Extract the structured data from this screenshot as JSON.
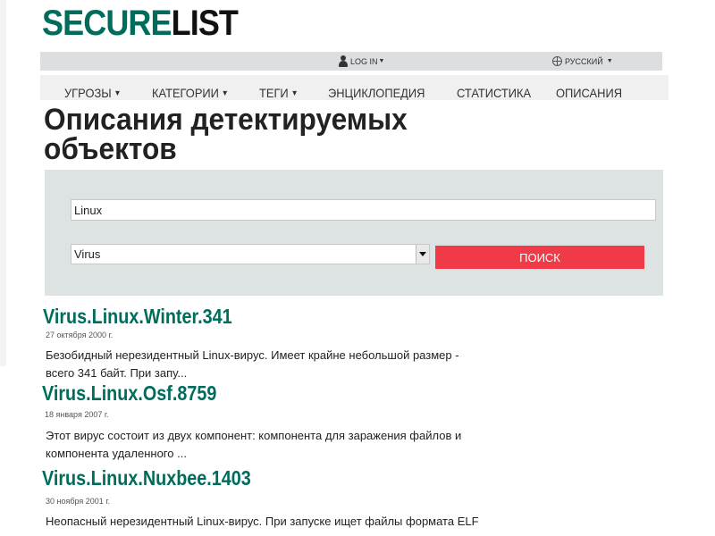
{
  "logo": {
    "part1": "SECURE",
    "part2": "LIST"
  },
  "topbar": {
    "login": "LOG IN",
    "language": "РУССКИЙ"
  },
  "nav": {
    "items": [
      {
        "label": "Угрозы",
        "dropdown": true
      },
      {
        "label": "Категории",
        "dropdown": true
      },
      {
        "label": "Теги",
        "dropdown": true
      },
      {
        "label": "Энциклопедия",
        "dropdown": false
      },
      {
        "label": "Статистика",
        "dropdown": false
      },
      {
        "label": "Описания",
        "dropdown": false
      }
    ]
  },
  "page": {
    "title": "Описания детектируемых объектов"
  },
  "search": {
    "query": "Linux",
    "type_selected": "Virus",
    "button_label": "ПОИСК",
    "button_color": "#f03a47"
  },
  "results": [
    {
      "title": "Virus.Linux.Winter.341",
      "date": "27 октября 2000 г.",
      "desc_line1": "Безобидный нерезидентный Linux-вирус. Имеет крайне небольшой размер -",
      "desc_line2": "всего 341 байт. При запу..."
    },
    {
      "title": "Virus.Linux.Osf.8759",
      "date": "18 января 2007 г.",
      "desc_line1": "Этот вирус состоит из двух компонент: компонента для заражения файлов и",
      "desc_line2": "компонента удаленного ..."
    },
    {
      "title": "Virus.Linux.Nuxbee.1403",
      "date": "30 ноября 2001 г.",
      "desc_line1": "Неопасный нерезидентный Linux-вирус. При запуске ищет файлы формата ELF",
      "desc_line2": ""
    }
  ],
  "colors": {
    "brand_green": "#006c5b",
    "accent_red": "#f03a47",
    "panel_bg": "#dde3e3"
  }
}
